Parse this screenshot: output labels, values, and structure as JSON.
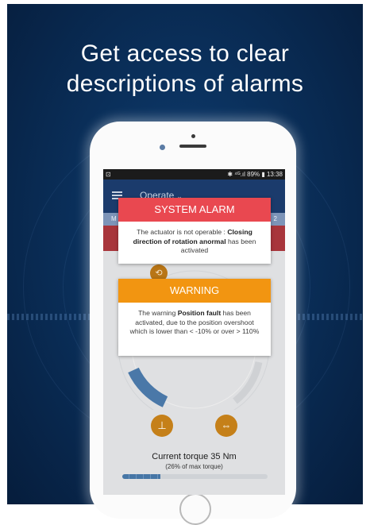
{
  "headline": {
    "line1": "Get access to clear",
    "line2": "descriptions of alarms"
  },
  "status_bar": {
    "left": "⊡",
    "right": "✱ ⁴ᴳ.ıl 89% ▮ 13:38"
  },
  "app_bar": {
    "menu_icon": "hamburger-menu-icon",
    "title": "Operate",
    "chevron": "⌄"
  },
  "info_strip": {
    "left": "M",
    "right": "2"
  },
  "alarm_popup": {
    "title": "SYSTEM ALARM",
    "text_before": "The actuator is not operable : ",
    "text_bold": "Closing direction of rotation anormal",
    "text_after": " has been activated",
    "color": "#e94850"
  },
  "warning_popup": {
    "title": "WARNING",
    "text_before": "The warning ",
    "text_bold": "Position fault",
    "text_after": " has been activated, due to the position overshoot which is lower than < -10% or over > 110%",
    "color": "#f29511"
  },
  "controls": {
    "rotate_icon": "rotate-icon",
    "rotate_glyph": "⟲",
    "close_icon": "close-valve-icon",
    "close_glyph": "⊥",
    "open_icon": "open-valve-icon",
    "open_glyph": "⇔"
  },
  "torque": {
    "title": "Current torque 35 Nm",
    "subtitle": "(26% of max torque)",
    "fraction": 0.26
  },
  "colors": {
    "background": "#0a2f5a",
    "app_bar": "#1b3b6c",
    "accent_orange": "#c58019",
    "dial_blue": "#4676a6"
  }
}
